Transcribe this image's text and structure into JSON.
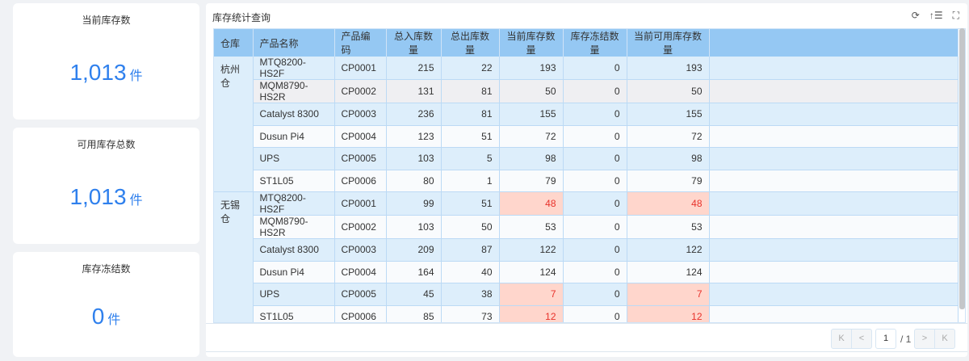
{
  "cards": [
    {
      "title": "当前库存数",
      "value": "1,013",
      "unit": "件"
    },
    {
      "title": "可用库存总数",
      "value": "1,013",
      "unit": "件"
    },
    {
      "title": "库存冻结数",
      "value": "0",
      "unit": "件"
    }
  ],
  "panel": {
    "title": "库存统计查询",
    "icons": [
      "refresh-icon",
      "sort-icon",
      "fullscreen-icon"
    ]
  },
  "table": {
    "headers": [
      "仓库",
      "产品名称",
      "产品编码",
      "总入库数量",
      "总出库数量",
      "当前库存数量",
      "库存冻结数量",
      "当前可用库存数量"
    ],
    "groups": [
      {
        "warehouse": "杭州仓",
        "rows": [
          [
            "MTQ8200-HS2F",
            "CP0001",
            "215",
            "22",
            "193",
            "0",
            "193"
          ],
          [
            "MQM8790-HS2R",
            "CP0002",
            "131",
            "81",
            "50",
            "0",
            "50"
          ],
          [
            "Catalyst 8300",
            "CP0003",
            "236",
            "81",
            "155",
            "0",
            "155"
          ],
          [
            "Dusun Pi4",
            "CP0004",
            "123",
            "51",
            "72",
            "0",
            "72"
          ],
          [
            "UPS",
            "CP0005",
            "103",
            "5",
            "98",
            "0",
            "98"
          ],
          [
            "ST1L05",
            "CP0006",
            "80",
            "1",
            "79",
            "0",
            "79"
          ]
        ]
      },
      {
        "warehouse": "无锡仓",
        "rows": [
          [
            "MTQ8200-HS2F",
            "CP0001",
            "99",
            "51",
            "48",
            "0",
            "48"
          ],
          [
            "MQM8790-HS2R",
            "CP0002",
            "103",
            "50",
            "53",
            "0",
            "53"
          ],
          [
            "Catalyst 8300",
            "CP0003",
            "209",
            "87",
            "122",
            "0",
            "122"
          ],
          [
            "Dusun Pi4",
            "CP0004",
            "164",
            "40",
            "124",
            "0",
            "124"
          ],
          [
            "UPS",
            "CP0005",
            "45",
            "38",
            "7",
            "0",
            "7"
          ],
          [
            "ST1L05",
            "CP0006",
            "85",
            "73",
            "12",
            "0",
            "12"
          ]
        ]
      }
    ],
    "warn_rows": [
      "无锡仓-0",
      "无锡仓-4",
      "无锡仓-5"
    ]
  },
  "pager": {
    "first": "K",
    "prev": "<",
    "page": "1",
    "total": "/ 1",
    "next": ">",
    "last": "K"
  },
  "colors": {
    "accent": "#2f80ed",
    "header": "#95c8f3",
    "warn_bg": "#ffd6cc",
    "warn_text": "#e8322b"
  }
}
